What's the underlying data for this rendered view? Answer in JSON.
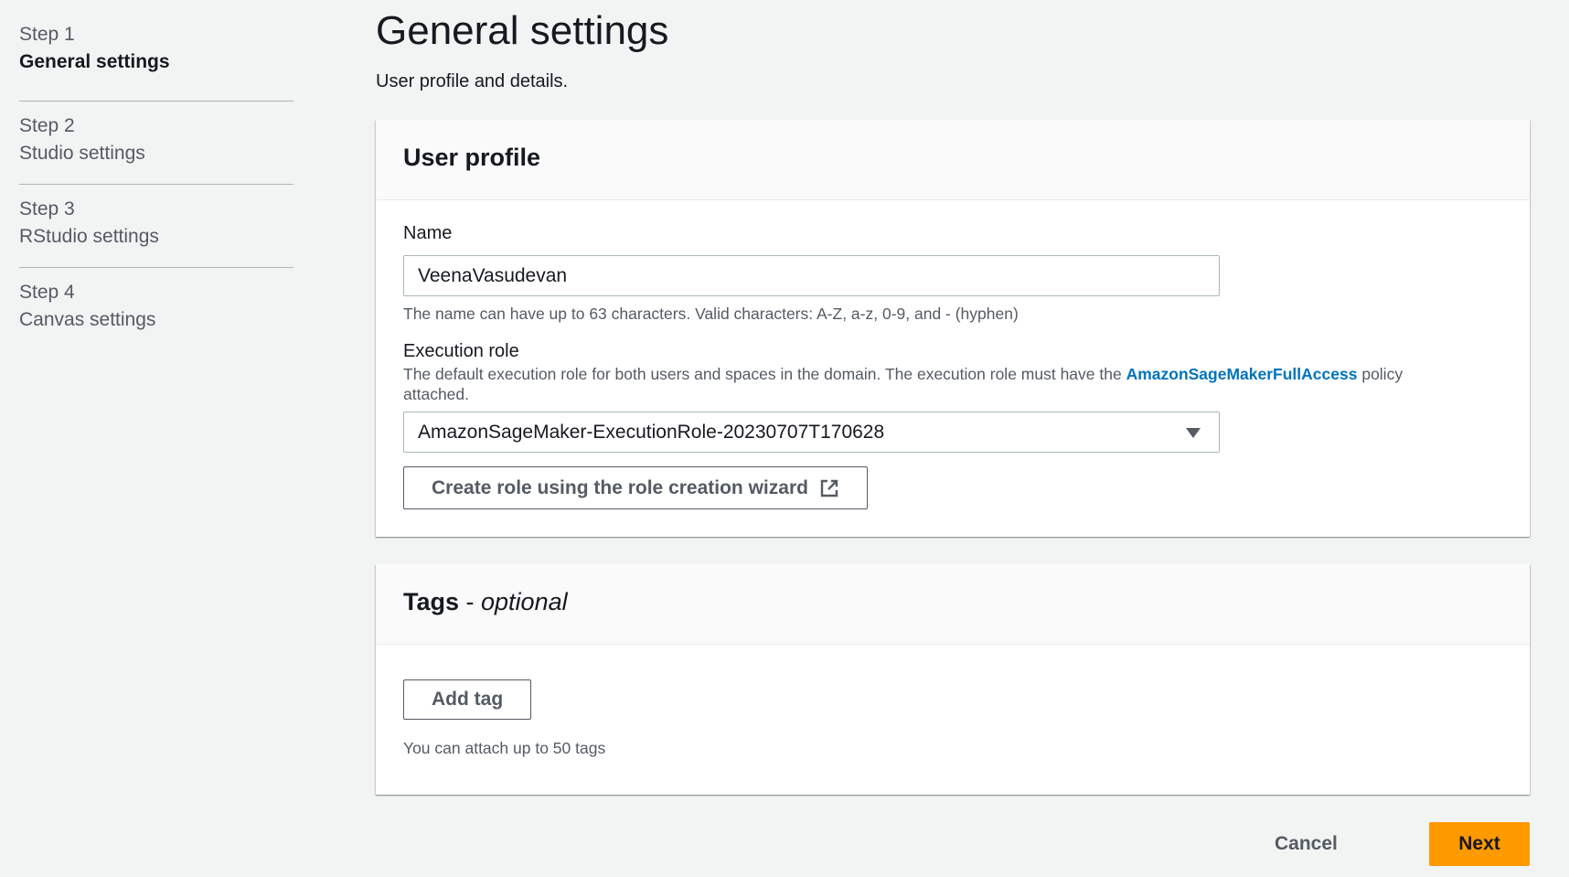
{
  "steps": [
    {
      "number": "Step 1",
      "title": "General settings",
      "active": true
    },
    {
      "number": "Step 2",
      "title": "Studio settings",
      "active": false
    },
    {
      "number": "Step 3",
      "title": "RStudio settings",
      "active": false
    },
    {
      "number": "Step 4",
      "title": "Canvas settings",
      "active": false
    }
  ],
  "page": {
    "title": "General settings",
    "description": "User profile and details."
  },
  "user_profile": {
    "header": "User profile",
    "name_label": "Name",
    "name_value": "VeenaVasudevan",
    "name_hint": "The name can have up to 63 characters. Valid characters: A-Z, a-z, 0-9, and - (hyphen)",
    "role_label": "Execution role",
    "role_hint_before": "The default execution role for both users and spaces in the domain. The execution role must have the ",
    "role_hint_link": "AmazonSageMakerFullAccess",
    "role_hint_after": " policy attached.",
    "role_selected": "AmazonSageMaker-ExecutionRole-20230707T170628",
    "create_role_button": "Create role using the role creation wizard",
    "create_role_icon": "external-link-icon"
  },
  "tags": {
    "header_bold": "Tags",
    "header_dash": " - ",
    "header_italic": "optional",
    "add_tag_button": "Add tag",
    "hint": "You can attach up to 50 tags"
  },
  "footer": {
    "cancel_label": "Cancel",
    "next_label": "Next"
  },
  "colors": {
    "primary_button": "#ff9900",
    "link": "#0073bb",
    "background": "#f2f3f3"
  }
}
